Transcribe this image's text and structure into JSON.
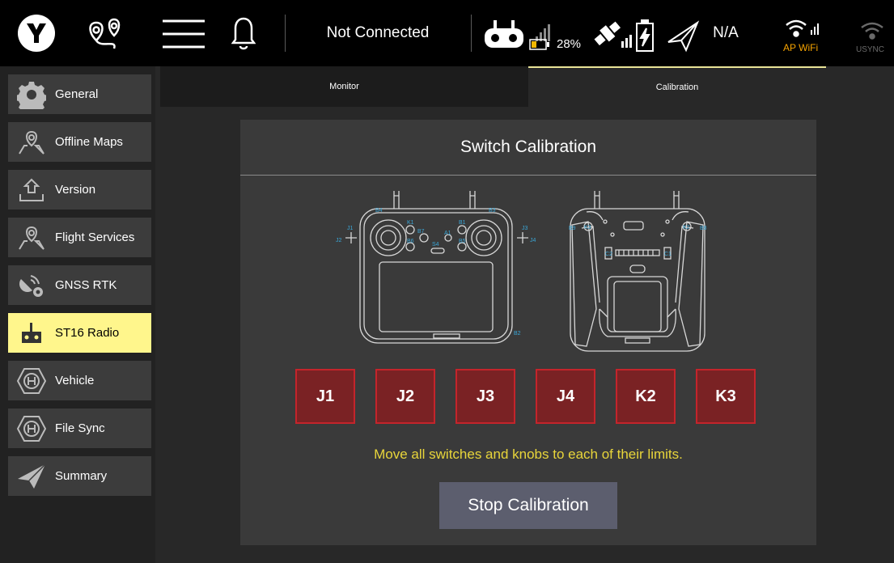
{
  "topbar": {
    "logo_icon": "qgc-logo-icon",
    "plan_icon": "plan-route-icon",
    "menu_icon": "hamburger-menu-icon",
    "notification_icon": "bell-icon",
    "connection_status": "Not Connected",
    "rc_battery": "28%",
    "battery_value": "N/A",
    "ap_wifi_label": "AP WiFi",
    "usync_label": "USYNC"
  },
  "sidebar": {
    "items": [
      {
        "label": "General",
        "icon": "gear-icon"
      },
      {
        "label": "Offline Maps",
        "icon": "map-pin-icon"
      },
      {
        "label": "Version",
        "icon": "upload-icon"
      },
      {
        "label": "Flight Services",
        "icon": "map-pin-icon"
      },
      {
        "label": "GNSS RTK",
        "icon": "satellite-gear-icon"
      },
      {
        "label": "ST16 Radio",
        "icon": "radio-controller-icon",
        "active": true
      },
      {
        "label": "Vehicle",
        "icon": "hexagon-h-icon"
      },
      {
        "label": "File Sync",
        "icon": "hexagon-h-icon"
      },
      {
        "label": "Summary",
        "icon": "paper-plane-icon"
      }
    ]
  },
  "tabs": {
    "monitor": "Monitor",
    "calibration": "Calibration"
  },
  "panel": {
    "title": "Switch Calibration",
    "diagram_labels": {
      "j1": "J1",
      "j2": "J2",
      "j3": "J3",
      "j4": "J4",
      "b1": "B1",
      "b2": "B2",
      "b3": "B3",
      "b4": "B4",
      "b5": "B5",
      "b6": "B6",
      "b7": "B7",
      "b8": "B8",
      "b9": "B9",
      "k1": "K1",
      "k2": "K2",
      "k3": "K3",
      "a1": "A1",
      "s4": "S4",
      "c1": "C1",
      "c2": "C2"
    },
    "switches": [
      "J1",
      "J2",
      "J3",
      "J4",
      "K2",
      "K3"
    ],
    "instruction": "Move all switches and knobs to each of their limits.",
    "stop_button": "Stop Calibration"
  },
  "colors": {
    "active_nav": "#fff68c",
    "switch_fill": "#7a2224",
    "switch_border": "#c4242b",
    "instruction": "#e8d53a",
    "ap_wifi": "#f7a400",
    "label_blue": "#3aa7d8"
  }
}
